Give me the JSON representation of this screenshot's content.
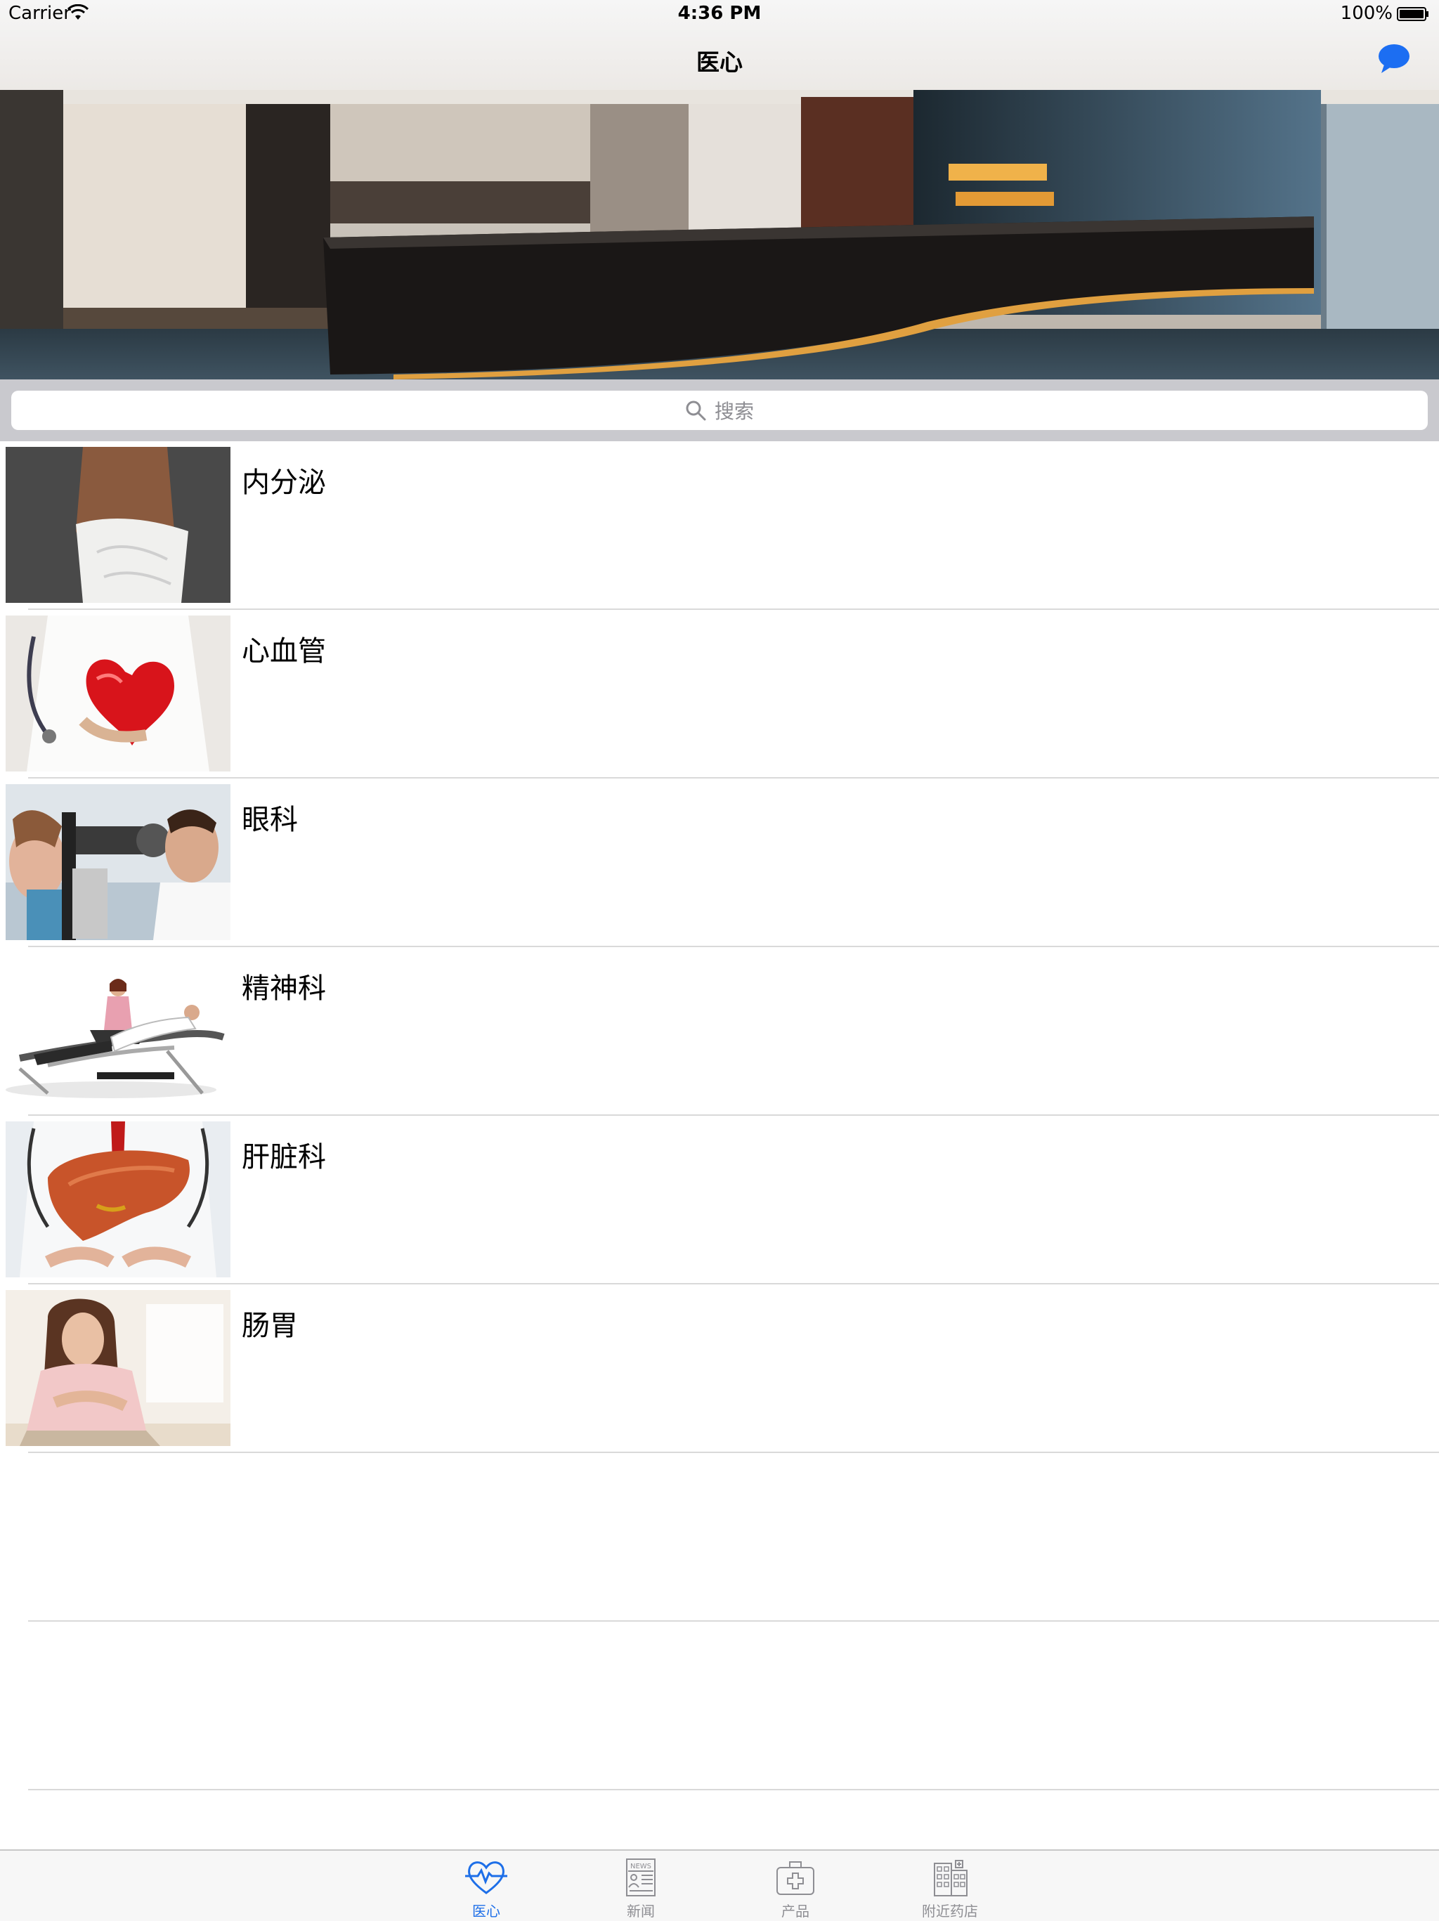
{
  "status_bar": {
    "carrier": "Carrier",
    "time": "4:36 PM",
    "battery": "100%"
  },
  "nav": {
    "title": "医心",
    "right_icon": "chat-bubble-icon"
  },
  "banner": {
    "description_icon": "hospital-reception-photo"
  },
  "search": {
    "placeholder": "搜索"
  },
  "departments": [
    {
      "label": "内分泌"
    },
    {
      "label": "心血管"
    },
    {
      "label": "眼科"
    },
    {
      "label": "精神科"
    },
    {
      "label": "肝脏科"
    },
    {
      "label": "肠胃"
    }
  ],
  "tabs": [
    {
      "label": "医心",
      "icon": "heart-pulse-icon",
      "active": true
    },
    {
      "label": "新闻",
      "icon": "newspaper-icon",
      "active": false
    },
    {
      "label": "产品",
      "icon": "medical-kit-icon",
      "active": false
    },
    {
      "label": "附近药店",
      "icon": "building-icon",
      "active": false
    }
  ],
  "colors": {
    "accent": "#1e6fe8",
    "search_bg": "#c9c9ce",
    "separator": "#d9d9d9"
  }
}
